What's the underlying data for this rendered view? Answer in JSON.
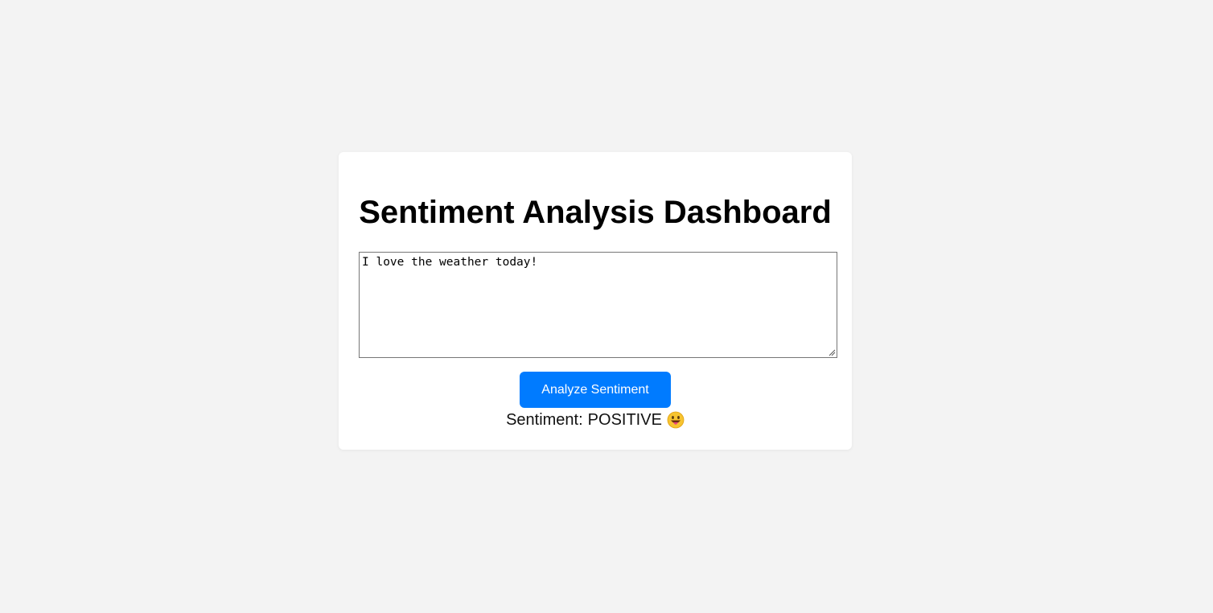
{
  "page": {
    "title": "Sentiment Analysis Dashboard"
  },
  "input": {
    "value": "I love the weather today!"
  },
  "button": {
    "label": "Analyze Sentiment",
    "color": "#007bff"
  },
  "result": {
    "prefix": "Sentiment:",
    "label": "POSITIVE",
    "icon": "grinning-tongue-emoji"
  }
}
